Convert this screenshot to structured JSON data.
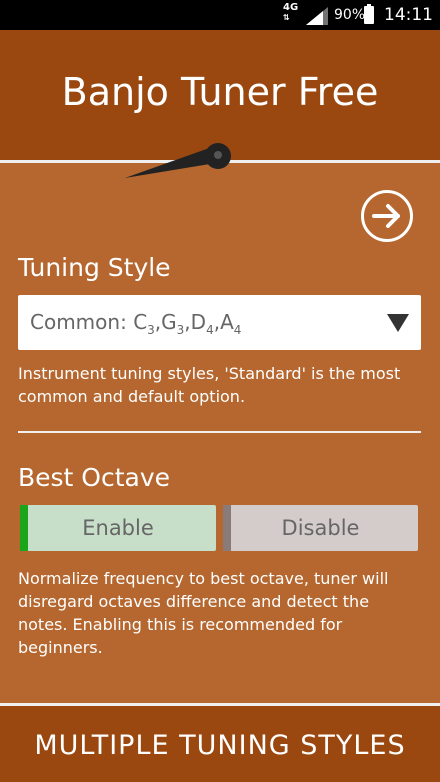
{
  "status_bar": {
    "network": "4G",
    "network_arrows": "⇅",
    "battery_percent": "90%",
    "time": "14:11"
  },
  "header": {
    "title": "Banjo Tuner Free"
  },
  "tuning_style": {
    "label": "Tuning Style",
    "selected": {
      "prefix": "Common: ",
      "notes": [
        {
          "note": "C",
          "octave": "3"
        },
        {
          "note": "G",
          "octave": "3"
        },
        {
          "note": "D",
          "octave": "4"
        },
        {
          "note": "A",
          "octave": "4"
        }
      ]
    },
    "hint": "Instrument tuning styles, 'Standard' is the most common and default option."
  },
  "best_octave": {
    "label": "Best Octave",
    "enable_label": "Enable",
    "disable_label": "Disable",
    "hint": "Normalize frequency to best octave, tuner will disregard octaves difference and detect the notes. Enabling this is recommended for beginners."
  },
  "footer": {
    "banner": "MULTIPLE TUNING STYLES"
  }
}
